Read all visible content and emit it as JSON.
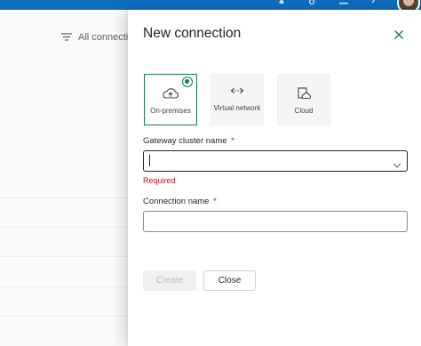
{
  "colors": {
    "accent": "#117865",
    "error": "#c50f1f",
    "topbar": "#0f6cbd"
  },
  "topbar": {
    "icons": [
      "bell-icon",
      "gear-icon",
      "download-icon",
      "help-icon"
    ],
    "avatar": "user-avatar"
  },
  "background": {
    "filter_label": "All connectio"
  },
  "panel": {
    "title": "New connection",
    "close_icon": "dismiss-icon",
    "connection_types": [
      {
        "label": "On-premises",
        "icon": "cloud-upload-icon",
        "selected": true
      },
      {
        "label": "Virtual network",
        "icon": "arrows-left-right-icon",
        "selected": false
      },
      {
        "label": "Cloud",
        "icon": "cloud-document-icon",
        "selected": false
      }
    ],
    "gateway": {
      "label": "Gateway cluster name",
      "required_mark": "*",
      "value": "",
      "error": "Required"
    },
    "connection_name": {
      "label": "Connection name",
      "required_mark": "*",
      "value": ""
    },
    "buttons": {
      "create": "Create",
      "close": "Close"
    }
  }
}
